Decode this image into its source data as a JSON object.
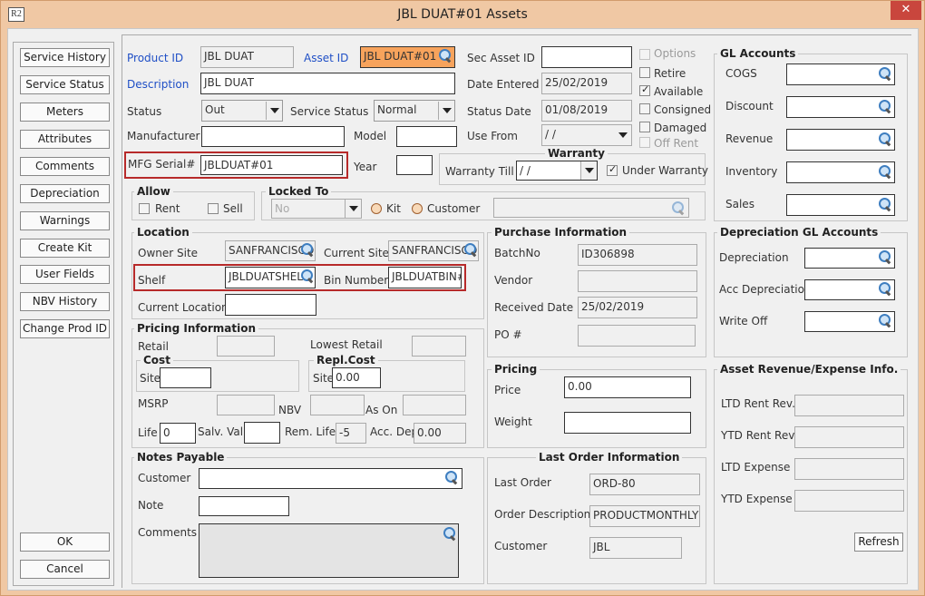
{
  "window": {
    "title": "JBL DUAT#01 Assets",
    "app_icon": "R2",
    "close": "✕"
  },
  "left_buttons": [
    "Service History",
    "Service Status",
    "Meters",
    "Attributes",
    "Comments",
    "Depreciation",
    "Warnings",
    "Create Kit",
    "User Fields",
    "NBV History",
    "Change Prod ID"
  ],
  "ok_label": "OK",
  "cancel_label": "Cancel",
  "main": {
    "product_id": {
      "label": "Product ID",
      "value": "JBL DUAT"
    },
    "asset_id": {
      "label": "Asset ID",
      "value": "JBL DUAT#01"
    },
    "sec_asset_id": {
      "label": "Sec Asset ID",
      "value": ""
    },
    "description": {
      "label": "Description",
      "value": "JBL DUAT"
    },
    "date_entered": {
      "label": "Date Entered",
      "value": "25/02/2019"
    },
    "status": {
      "label": "Status",
      "value": "Out"
    },
    "service_status": {
      "label": "Service Status",
      "value": "Normal"
    },
    "status_date": {
      "label": "Status Date",
      "value": "01/08/2019"
    },
    "manufacturer": {
      "label": "Manufacturer",
      "value": ""
    },
    "model": {
      "label": "Model",
      "value": ""
    },
    "use_from": {
      "label": "Use From",
      "value": " / /"
    },
    "mfg_serial": {
      "label": "MFG Serial#",
      "value": "JBLDUAT#01"
    },
    "year": {
      "label": "Year",
      "value": ""
    }
  },
  "options": {
    "options": "Options",
    "retire": "Retire",
    "available": "Available",
    "consigned": "Consigned",
    "damaged": "Damaged",
    "off_rent": "Off Rent"
  },
  "warranty": {
    "title": "Warranty",
    "till_label": "Warranty Till",
    "till_value": " / /",
    "under_label": "Under Warranty"
  },
  "allow": {
    "title": "Allow",
    "rent": "Rent",
    "sell": "Sell"
  },
  "locked_to": {
    "title": "Locked To",
    "value": "No",
    "kit": "Kit",
    "customer": "Customer"
  },
  "location": {
    "title": "Location",
    "owner_site": "Owner Site",
    "owner_site_value": "SANFRANCISCO",
    "current_site": "Current Site",
    "current_site_value": "SANFRANCISCO",
    "shelf": "Shelf",
    "shelf_value": "JBLDUATSHELF",
    "bin_number": "Bin Number",
    "bin_value": "JBLDUATBIN#",
    "current_location": "Current Location"
  },
  "pricing_info": {
    "title": "Pricing Information",
    "retail": "Retail",
    "lowest_retail": "Lowest Retail",
    "cost": "Cost",
    "site": "Site",
    "repl_cost": "Repl.Cost",
    "repl_site_value": "0.00",
    "msrp": "MSRP",
    "nbv": "NBV",
    "as_on": "As On",
    "life": "Life",
    "life_value": "0",
    "salv_val": "Salv. Val",
    "rem_life": "Rem. Life",
    "rem_life_value": "-5",
    "acc_dep": "Acc. Dep",
    "acc_dep_value": "0.00"
  },
  "purchase": {
    "title": "Purchase Information",
    "batchno": "BatchNo",
    "batchno_value": "ID306898",
    "vendor": "Vendor",
    "received_date": "Received Date",
    "received_value": "25/02/2019",
    "po": "PO #"
  },
  "pricing": {
    "title": "Pricing",
    "price": "Price",
    "price_value": "0.00",
    "weight": "Weight"
  },
  "notes": {
    "title": "Notes Payable",
    "customer": "Customer",
    "note": "Note",
    "comments": "Comments"
  },
  "last_order": {
    "title": "Last Order Information",
    "last_order": "Last Order",
    "last_order_value": "ORD-80",
    "order_desc": "Order Description",
    "order_desc_value": "PRODUCTMONTHLY",
    "customer": "Customer",
    "customer_value": "JBL"
  },
  "gl_accounts": {
    "title": "GL Accounts",
    "items": [
      "COGS",
      "Discount",
      "Revenue",
      "Inventory",
      "Sales"
    ]
  },
  "dep_gl": {
    "title": "Depreciation GL Accounts",
    "items": [
      "Depreciation",
      "Acc Depreciation",
      "Write Off"
    ]
  },
  "rev_exp": {
    "title": "Asset Revenue/Expense Info.",
    "items": [
      "LTD Rent Rev.",
      "YTD Rent Rev.",
      "LTD Expense",
      "YTD Expense"
    ],
    "refresh": "Refresh"
  },
  "colors": {
    "asset_id_bg": "#f7a35c",
    "label_blue": "#1f4fc6",
    "highlight_red": "#b72a2a",
    "title_bg": "#f0c8a4",
    "close_red": "#c9463d"
  }
}
